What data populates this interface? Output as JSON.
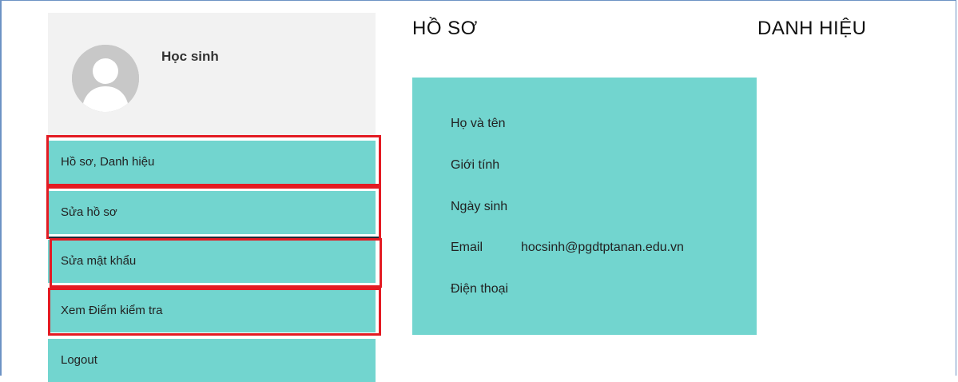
{
  "profile": {
    "user_name": "Học sinh"
  },
  "menu": {
    "items": [
      {
        "label": "Hồ sơ, Danh hiệu"
      },
      {
        "label": "Sửa hồ sơ"
      },
      {
        "label": "Sửa mật khẩu"
      },
      {
        "label": "Xem Điểm kiểm tra"
      },
      {
        "label": "Logout"
      }
    ]
  },
  "headings": {
    "profile": "HỒ SƠ",
    "titles": "DANH HIỆU"
  },
  "info": {
    "fields": [
      {
        "label": "Họ và tên",
        "value": ""
      },
      {
        "label": "Giới tính",
        "value": ""
      },
      {
        "label": "Ngày sinh",
        "value": ""
      },
      {
        "label": "Email",
        "value": "hocsinh@pgdtptanan.edu.vn"
      },
      {
        "label": "Điện thoại",
        "value": ""
      }
    ]
  },
  "colors": {
    "accent": "#72d5cf",
    "highlight": "#e31b23",
    "profile_bg": "#f2f2f2"
  }
}
